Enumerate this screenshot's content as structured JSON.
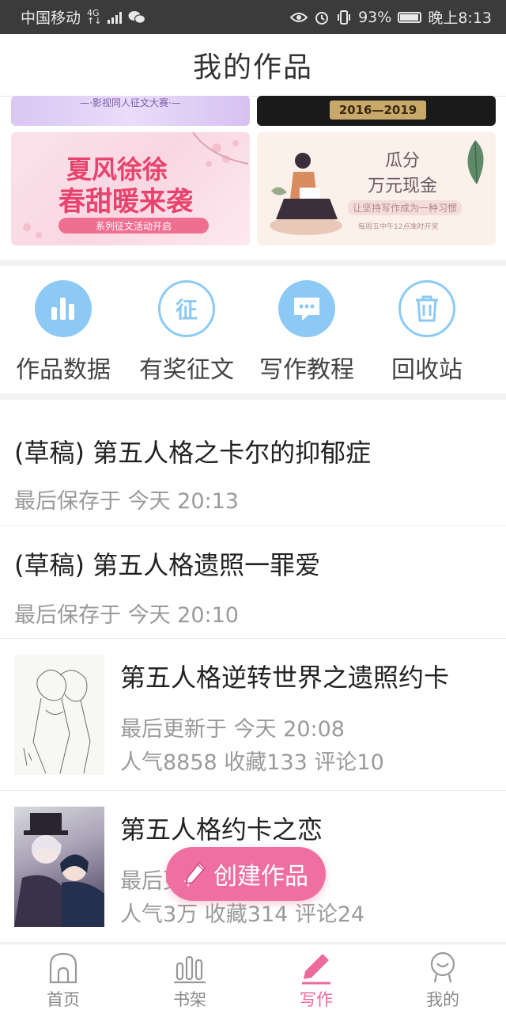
{
  "status_bar": {
    "carrier": "中国移动",
    "network_top": "4G",
    "network_bottom": "↑↓",
    "battery": "93%",
    "time": "晚上8:13"
  },
  "header": {
    "title": "我的作品"
  },
  "banners": {
    "top_left_text": "—·影视同人征文大赛·—",
    "top_right_text": "2016—2019",
    "pink": {
      "line1": "夏风徐徐",
      "line2": "春甜暖来袭",
      "ribbon": "系列征文活动开启"
    },
    "cream": {
      "title1": "瓜分",
      "title2": "万元现金",
      "subtitle": "让坚持写作成为一种习惯",
      "footnote": "每周五中午12点准时开奖"
    }
  },
  "quick_actions": [
    {
      "label": "作品数据",
      "icon": "bar-chart-icon"
    },
    {
      "label": "有奖征文",
      "icon": "zheng-icon",
      "glyph": "征"
    },
    {
      "label": "写作教程",
      "icon": "chat-bubble-icon",
      "glyph": "•••"
    },
    {
      "label": "回收站",
      "icon": "trash-icon"
    }
  ],
  "works": [
    {
      "type": "draft",
      "title": "(草稿) 第五人格之卡尔的抑郁症",
      "meta": "最后保存于 今天 20:13"
    },
    {
      "type": "draft",
      "title": "(草稿) 第五人格遗照一罪爱",
      "meta": "最后保存于 今天 20:10"
    },
    {
      "type": "book",
      "title": "第五人格逆转世界之遗照约卡",
      "meta": "最后更新于 今天 20:08",
      "stats": "人气8858 收藏133 评论10"
    },
    {
      "type": "book",
      "title": "第五人格约卡之恋",
      "meta": "最后更新于 今天",
      "stats": "人气3万 收藏314 评论24"
    }
  ],
  "fab": {
    "label": "创建作品"
  },
  "bottom_nav": [
    {
      "label": "首页",
      "icon": "home-icon",
      "active": false
    },
    {
      "label": "书架",
      "icon": "bookshelf-icon",
      "active": false
    },
    {
      "label": "写作",
      "icon": "pen-icon",
      "active": true
    },
    {
      "label": "我的",
      "icon": "profile-icon",
      "active": false
    }
  ],
  "colors": {
    "accent_pink": "#ec6a9c",
    "icon_blue": "#8ccaf5",
    "status_bar": "#3b3b3b"
  }
}
